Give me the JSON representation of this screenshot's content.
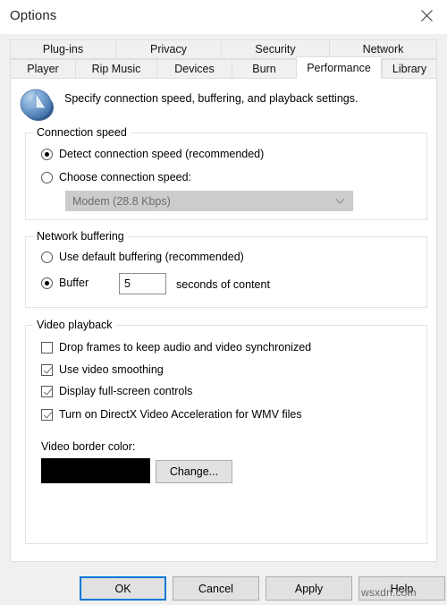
{
  "window": {
    "title": "Options",
    "close_icon": "close-icon"
  },
  "tabs": {
    "row_top": [
      {
        "label": "Plug-ins",
        "width": 118,
        "selected": false
      },
      {
        "label": "Privacy",
        "width": 115,
        "selected": false
      },
      {
        "label": "Security",
        "width": 124,
        "selected": false
      },
      {
        "label": "Network",
        "width": 121,
        "selected": false
      }
    ],
    "row_bottom": [
      {
        "label": "Player",
        "width": 73,
        "selected": false
      },
      {
        "label": "Rip Music",
        "width": 91,
        "selected": false
      },
      {
        "label": "Devices",
        "width": 84,
        "selected": false
      },
      {
        "label": "Burn",
        "width": 72,
        "selected": false
      },
      {
        "label": "Performance",
        "width": 96,
        "selected": true
      },
      {
        "label": "Library",
        "width": 62,
        "selected": false
      }
    ]
  },
  "header": {
    "icon": "windows-media-player-icon",
    "description": "Specify connection speed, buffering, and playback settings."
  },
  "connection_speed": {
    "legend": "Connection speed",
    "options": [
      {
        "label": "Detect connection speed (recommended)",
        "checked": true
      },
      {
        "label": "Choose connection speed:",
        "checked": false
      }
    ],
    "dropdown": {
      "value": "Modem (28.8 Kbps)",
      "disabled": true,
      "arrow_icon": "chevron-down-icon"
    }
  },
  "network_buffering": {
    "legend": "Network buffering",
    "options": [
      {
        "label": "Use default buffering (recommended)",
        "checked": false
      },
      {
        "label": "Buffer",
        "checked": true
      }
    ],
    "buffer_seconds": "5",
    "suffix_label": "seconds of content"
  },
  "video_playback": {
    "legend": "Video playback",
    "checkboxes": [
      {
        "label": "Drop frames to keep audio and video synchronized",
        "checked": false
      },
      {
        "label": "Use video smoothing",
        "checked": true
      },
      {
        "label": "Display full-screen controls",
        "checked": true
      },
      {
        "label": "Turn on DirectX Video Acceleration for WMV files",
        "checked": true
      }
    ],
    "border_color_label": "Video border color:",
    "border_color_value": "#000000",
    "change_button": "Change..."
  },
  "footer": {
    "ok": "OK",
    "cancel": "Cancel",
    "apply": "Apply",
    "help": "Help"
  },
  "watermark": "wsxdn.com",
  "colors": {
    "accent": "#0078d7",
    "dialog_bg": "#f0f0f0",
    "panel_bg": "#ffffff",
    "button_bg": "#e1e1e1",
    "disabled_combo_bg": "#cccccc"
  }
}
